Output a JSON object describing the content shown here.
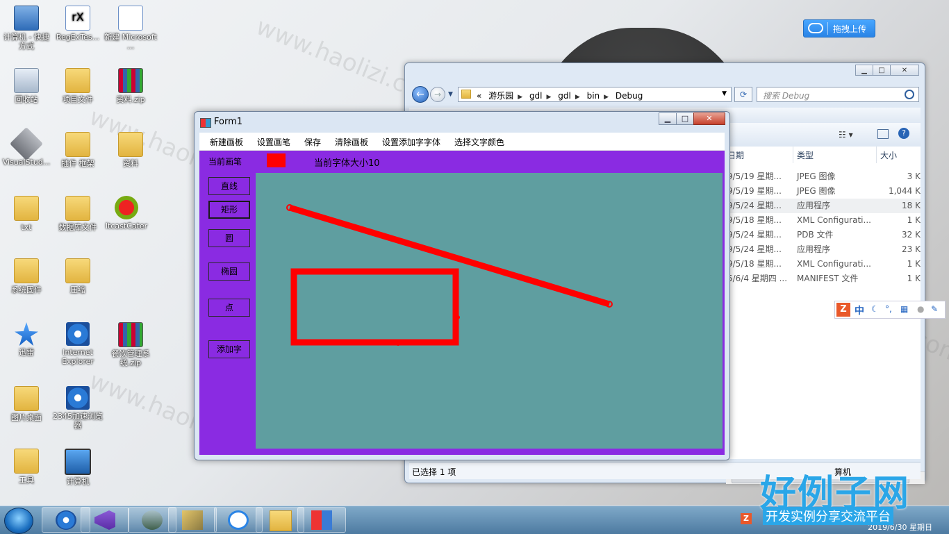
{
  "desktop_icons": [
    {
      "label": "计算机 - 快捷方式",
      "icon": "computer-shortcut-icon"
    },
    {
      "label": "RegExTes...",
      "icon": "regex-tester-icon"
    },
    {
      "label": "新建 Microsoft ...",
      "icon": "word-document-icon"
    },
    {
      "label": "回收站",
      "icon": "recycle-bin-icon"
    },
    {
      "label": "项目文件",
      "icon": "folder-icon"
    },
    {
      "label": "资料.zip",
      "icon": "winrar-archive-icon"
    },
    {
      "label": "VisualStud...",
      "icon": "visual-studio-icon"
    },
    {
      "label": "插件 框架",
      "icon": "folder-icon"
    },
    {
      "label": "资料",
      "icon": "folder-icon"
    },
    {
      "label": "txt",
      "icon": "folder-icon"
    },
    {
      "label": "数据库文件",
      "icon": "folder-icon"
    },
    {
      "label": "ItcastCater",
      "icon": "app-warning-icon"
    },
    {
      "label": "系统固件",
      "icon": "folder-icon"
    },
    {
      "label": "压缩",
      "icon": "folder-icon"
    },
    {
      "label": "迅雷",
      "icon": "thunder-icon"
    },
    {
      "label": "Internet Explorer",
      "icon": "internet-explorer-icon"
    },
    {
      "label": "餐饮管理系统.zip",
      "icon": "winrar-archive-icon"
    },
    {
      "label": "图片桌面",
      "icon": "folder-icon"
    },
    {
      "label": "2345加速浏览器",
      "icon": "browser-2345-icon"
    },
    {
      "label": "工具",
      "icon": "folder-icon"
    },
    {
      "label": "计算机",
      "icon": "computer-icon"
    }
  ],
  "baidu_upload": {
    "label": "拖拽上传"
  },
  "explorer": {
    "address": [
      "游乐园",
      "gdl",
      "gdl",
      "bin",
      "Debug"
    ],
    "address_prefix": "«",
    "search_placeholder": "搜索 Debug",
    "columns": {
      "date": "日期",
      "type": "类型",
      "size": "大小"
    },
    "rows": [
      {
        "date": "9/5/19 星期...",
        "type": "JPEG 图像",
        "size": "3 K"
      },
      {
        "date": "9/5/19 星期...",
        "type": "JPEG 图像",
        "size": "1,044 K"
      },
      {
        "date": "9/5/24 星期...",
        "type": "应用程序",
        "size": "18 K"
      },
      {
        "date": "9/5/18 星期...",
        "type": "XML Configurati...",
        "size": "1 K"
      },
      {
        "date": "9/5/24 星期...",
        "type": "PDB 文件",
        "size": "32 K"
      },
      {
        "date": "9/5/24 星期...",
        "type": "应用程序",
        "size": "23 K"
      },
      {
        "date": "9/5/18 星期...",
        "type": "XML Configurati...",
        "size": "1 K"
      },
      {
        "date": "5/6/4 星期四 ...",
        "type": "MANIFEST 文件",
        "size": "1 K"
      }
    ],
    "status": "已选择 1 项",
    "status_right": "算机"
  },
  "ime": {
    "zh": "中"
  },
  "form1": {
    "title": "Form1",
    "menu": [
      "新建画板",
      "设置画笔",
      "保存",
      "清除画板",
      "设置添加字字体",
      "选择文字颜色"
    ],
    "current_pen_label": "当前画笔",
    "pen_color": "#ff0000",
    "font_size_label": "当前字体大小10",
    "tools": [
      "直线",
      "矩形",
      "圆",
      "椭圆",
      "点",
      "添加字"
    ],
    "active_tool": "矩形",
    "canvas_color": "#5f9ea0",
    "client_color": "#8a2be2"
  },
  "taskbar": {
    "items": [
      "internet-explorer",
      "visual-studio",
      "photo-viewer",
      "tools-app",
      "baidu-netdisk",
      "file-explorer",
      "form1-app"
    ],
    "clock": "2019/6/30 星期日"
  },
  "watermark": "www.haolizi.com",
  "brand": {
    "title": "好例子网",
    "subtitle": "开发实例分享交流平台"
  }
}
